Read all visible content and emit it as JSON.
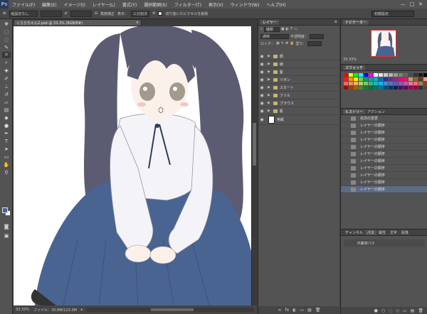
{
  "app": {
    "logo": "Ps"
  },
  "menu": [
    "ファイル(F)",
    "編集(E)",
    "イメージ(I)",
    "レイヤー(L)",
    "書式(Y)",
    "選択範囲(S)",
    "フィルター(T)",
    "表示(V)",
    "ウィンドウ(W)",
    "ヘルプ(H)"
  ],
  "window_controls": [
    "—",
    "□",
    "✕"
  ],
  "options": {
    "mode": "幅設定なし",
    "refine_label": "角度補正",
    "display_label": "表示：",
    "display_value": "三分割法",
    "delete_pixels": "切り抜いたピクセルを削除",
    "workspace": "初期設定"
  },
  "document": {
    "tab_title": "くららちゃん2.psd @ 33.3% (RGB/8#)",
    "close": "×",
    "zoom": "33.33%",
    "file_info": "ファイル：33.8M/123.3M"
  },
  "layers_panel": {
    "tabs": [
      "レイヤー"
    ],
    "kind_label": "種類",
    "blend_mode": "通常",
    "opacity_label": "不透明度：",
    "lock_label": "ロック：",
    "fill_label": "塗り：",
    "layers": [
      {
        "name": "顔"
      },
      {
        "name": "線"
      },
      {
        "name": "髪"
      },
      {
        "name": "リボン"
      },
      {
        "name": "スカート"
      },
      {
        "name": "フリル"
      },
      {
        "name": "ブラウス"
      },
      {
        "name": "肌"
      }
    ],
    "background_name": "用紙",
    "footer_icons": [
      "∞",
      "fx",
      "◐",
      "▭",
      "▤",
      "🗑"
    ]
  },
  "navigator": {
    "tab": "ナビゲーター",
    "zoom": "33.33%"
  },
  "swatches": {
    "tab": "スウォッチ",
    "colors": [
      "#ff0000",
      "#ffff00",
      "#00ff00",
      "#00ffff",
      "#0000ff",
      "#ff00ff",
      "#ffffff",
      "#e6e6e6",
      "#cccccc",
      "#b3b3b3",
      "#999999",
      "#808080",
      "#666666",
      "#4d4d4d",
      "#333333",
      "#1a1a1a",
      "#000000",
      "#f2d6c9",
      "#ed1c24",
      "#f7941d",
      "#fff200",
      "#8dc63f",
      "#00a651",
      "#00a99d",
      "#00aeef",
      "#0072bc",
      "#2e3192",
      "#662d91",
      "#92278f",
      "#ec008c",
      "#ed145b",
      "#c69c6d",
      "#8c6239",
      "#603913",
      "#f5989d",
      "#fdc689",
      "#f26c4f",
      "#f68e56",
      "#fbaf5d",
      "#acd373",
      "#7cc576",
      "#3bb878",
      "#1abbb4",
      "#00bff3",
      "#448ccb",
      "#5674b9",
      "#605ca8",
      "#855fa8",
      "#a864a8",
      "#f06eaa",
      "#f26d7d",
      "#a67c52",
      "#754c24",
      "#c4df9b",
      "#9e0b0f",
      "#a0410d",
      "#a3620a",
      "#598527",
      "#197b30",
      "#007236",
      "#00746b",
      "#0076a3",
      "#004a80",
      "#003471",
      "#1b1464",
      "#440e62",
      "#630460",
      "#9e005d",
      "#9d0039",
      "#362f2d",
      "#534741",
      "#998675"
    ]
  },
  "history": {
    "tabs": [
      "ヒストリー",
      "アクション"
    ],
    "items": [
      "名前の変更",
      "レイヤーの順序",
      "レイヤーの順序",
      "レイヤーの順序",
      "レイヤーの順序",
      "レイヤーの順序",
      "レイヤーの順序",
      "レイヤーの順序",
      "レイヤーの順序",
      "レイヤーの順序",
      "レイヤーの順序"
    ]
  },
  "paths": {
    "tabs": [
      "チャンネル",
      "パス",
      "属性",
      "文字",
      "段落"
    ],
    "item": "作業用パス"
  },
  "colors": {
    "hair": "#5b5b72",
    "skirt": "#4a6491",
    "skin": "#fbf1ea",
    "blouse": "#f4f3f8",
    "eyes": "#a39a8e",
    "panel": "#535353",
    "accent": "#e03030"
  }
}
